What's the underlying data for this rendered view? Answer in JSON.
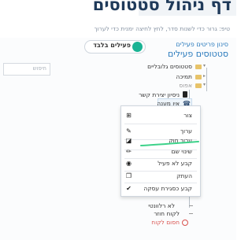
{
  "header": {
    "title": "דף ניהול סטטוסים",
    "subtitle": "טיפ: גרור כדי לשנות סדר, לחץ לחיצה ימנית כדי לערוך"
  },
  "toolbar": {
    "active_only_label": "פעילים בלבד",
    "filter_link": "סינון פריטים פעילים"
  },
  "section": {
    "title": "סטטוסים פעילים"
  },
  "search": {
    "placeholder": "חיפוש"
  },
  "tree": {
    "root": "סטטוסים גלובליים",
    "folder_2": "תמיכה",
    "folder_3": "אפוס",
    "node_contact": "ניסיון יצירת קשר",
    "node_no_answer": "אין מענה",
    "node_not_relevant": "לא רלוונטי",
    "node_returning_customer": "לקוח חוזר",
    "node_block_customer": "חסום לקוח"
  },
  "context_menu": {
    "items": [
      {
        "label": "צור",
        "icon": "plus-box-icon"
      },
      {
        "label": "ערוך",
        "icon": "edit-icon"
      },
      {
        "label": "ערוך חוק",
        "icon": "edit-rule-icon"
      },
      {
        "label": "שינוי שם",
        "icon": "pencil-icon"
      },
      {
        "label": "קבע לא פעיל",
        "icon": "eye-off-icon"
      },
      {
        "label": "העתק",
        "icon": "copy-icon"
      },
      {
        "label": "קבע כסגירת עסקה",
        "icon": "check-circle-icon"
      }
    ]
  },
  "colors": {
    "title": "#1f3a5a",
    "link": "#2b7bbd",
    "toggle_on": "#1ab394",
    "highlight": "#3dd28a",
    "danger": "#d9534f"
  }
}
